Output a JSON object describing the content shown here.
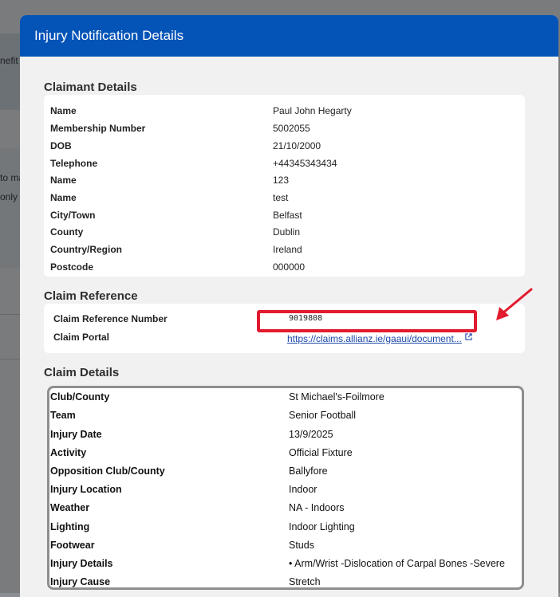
{
  "background": {
    "fragments": [
      "nefit",
      "to ma",
      "only"
    ]
  },
  "modal": {
    "title": "Injury Notification Details",
    "claimant": {
      "heading": "Claimant Details",
      "rows": [
        {
          "label": "Name",
          "value": "Paul John Hegarty"
        },
        {
          "label": "Membership Number",
          "value": "5002055"
        },
        {
          "label": "DOB",
          "value": "21/10/2000"
        },
        {
          "label": "Telephone",
          "value": "+44345343434"
        },
        {
          "label": "Name",
          "value": "123"
        },
        {
          "label": "Name",
          "value": "test"
        },
        {
          "label": "City/Town",
          "value": "Belfast"
        },
        {
          "label": "County",
          "value": "Dublin"
        },
        {
          "label": "Country/Region",
          "value": "Ireland"
        },
        {
          "label": "Postcode",
          "value": "000000"
        }
      ]
    },
    "claim_reference": {
      "heading": "Claim Reference",
      "reference_label": "Claim Reference Number",
      "reference_value": "9019808",
      "portal_label": "Claim Portal",
      "portal_link": "https://claims.allianz.ie/gaaui/document..."
    },
    "claim_details": {
      "heading": "Claim Details",
      "rows": [
        {
          "label": "Club/County",
          "value": "St Michael's-Foilmore"
        },
        {
          "label": "Team",
          "value": "Senior Football"
        },
        {
          "label": "Injury Date",
          "value": "13/9/2025"
        },
        {
          "label": "Activity",
          "value": "Official Fixture"
        },
        {
          "label": "Opposition Club/County",
          "value": "Ballyfore"
        },
        {
          "label": "Injury Location",
          "value": "Indoor"
        },
        {
          "label": "Weather",
          "value": "NA - Indoors"
        },
        {
          "label": "Lighting",
          "value": "Indoor Lighting"
        },
        {
          "label": "Footwear",
          "value": "Studs"
        },
        {
          "label": "Injury Details",
          "value": "• Arm/Wrist -Dislocation of Carpal Bones -Severe"
        },
        {
          "label": "Injury Cause",
          "value": "Stretch"
        }
      ]
    }
  },
  "colors": {
    "header": "#0453b7",
    "annotation": "#e21b2f",
    "link": "#1b47a8"
  },
  "icons": {
    "external_link": "external-link-icon",
    "annotation_arrow": "arrow-icon"
  }
}
